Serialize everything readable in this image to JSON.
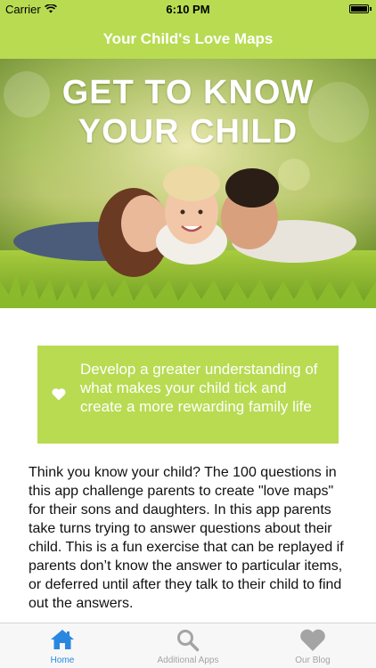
{
  "status_bar": {
    "carrier": "Carrier",
    "time": "6:10 PM"
  },
  "nav": {
    "title": "Your Child's Love Maps"
  },
  "hero": {
    "line1": "GET TO KNOW",
    "line2": "YOUR CHILD"
  },
  "tagline": {
    "text": "Develop a greater understanding of what makes your child tick and create a more rewarding family life"
  },
  "description": "Think you know your child? The 100 questions in this app challenge parents to create \"love maps\" for their sons and daughters. In this app parents take turns trying to answer questions about their child. This is a fun exercise that can be replayed if parents don’t know the answer to particular items, or deferred until after they talk to their child to find out the answers.",
  "tabs": [
    {
      "label": "Home",
      "icon": "home-icon",
      "active": true
    },
    {
      "label": "Additional Apps",
      "icon": "search-icon",
      "active": false
    },
    {
      "label": "Our Blog",
      "icon": "heart-icon",
      "active": false
    }
  ],
  "colors": {
    "accent": "#b8db52",
    "tab_active": "#2a87e0",
    "tab_inactive": "#a4a4a4"
  }
}
